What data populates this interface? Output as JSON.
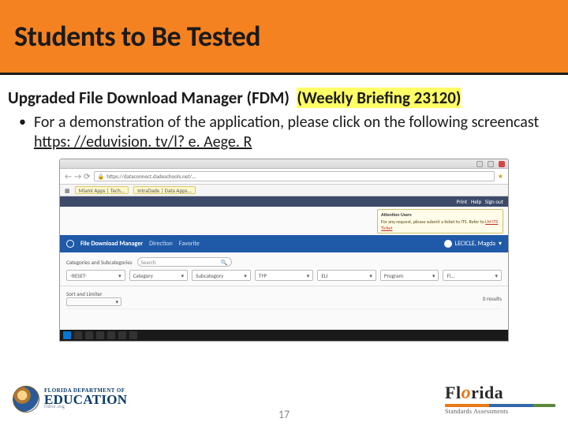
{
  "title": "Students to Be Tested",
  "subhead": {
    "main": "Upgraded File Download Manager (FDM)",
    "highlight_suffix": "(Weekly Briefing 23120)"
  },
  "bullet": {
    "prefix": "For a demonstration of the application, please click on the following screencast ",
    "link_text": "https: //eduvision. tv/l? e. Aege. R"
  },
  "browser": {
    "url": "https://dataconnect.dadeschools.net/...",
    "bookmarks": [
      "Miami Apps | Tech...",
      "IntraDade | Data Apps..."
    ],
    "menu_items": [
      "Print",
      "Help",
      "Sign out"
    ],
    "notice_title": "Attention Users",
    "notice_body": "For any request, please submit a ticket to ITS. Refer to ",
    "notice_ticket": "LM ITS Ticket",
    "brand": "File Download Manager",
    "nav_tabs": [
      "Direction",
      "Favorite"
    ],
    "user": "LECICLE, Magda",
    "filters_head": "Categories and Subcategories",
    "search_placeholder": "Search",
    "dropdowns": [
      "-RESET-",
      "Category",
      "Subcategory",
      "TYP",
      "ELI",
      "Program",
      "Fi..."
    ],
    "list_label": "Sort and Limiter",
    "list_count": "0 results"
  },
  "page_number": "17",
  "logo_left": {
    "small": "FLORIDA DEPARTMENT OF",
    "big": "EDUCATION",
    "vsmall": "fldoe.org"
  },
  "logo_right": {
    "main_a": "Fl",
    "main_b": "o",
    "main_c": "rida",
    "sub": "Standards Assessments"
  }
}
